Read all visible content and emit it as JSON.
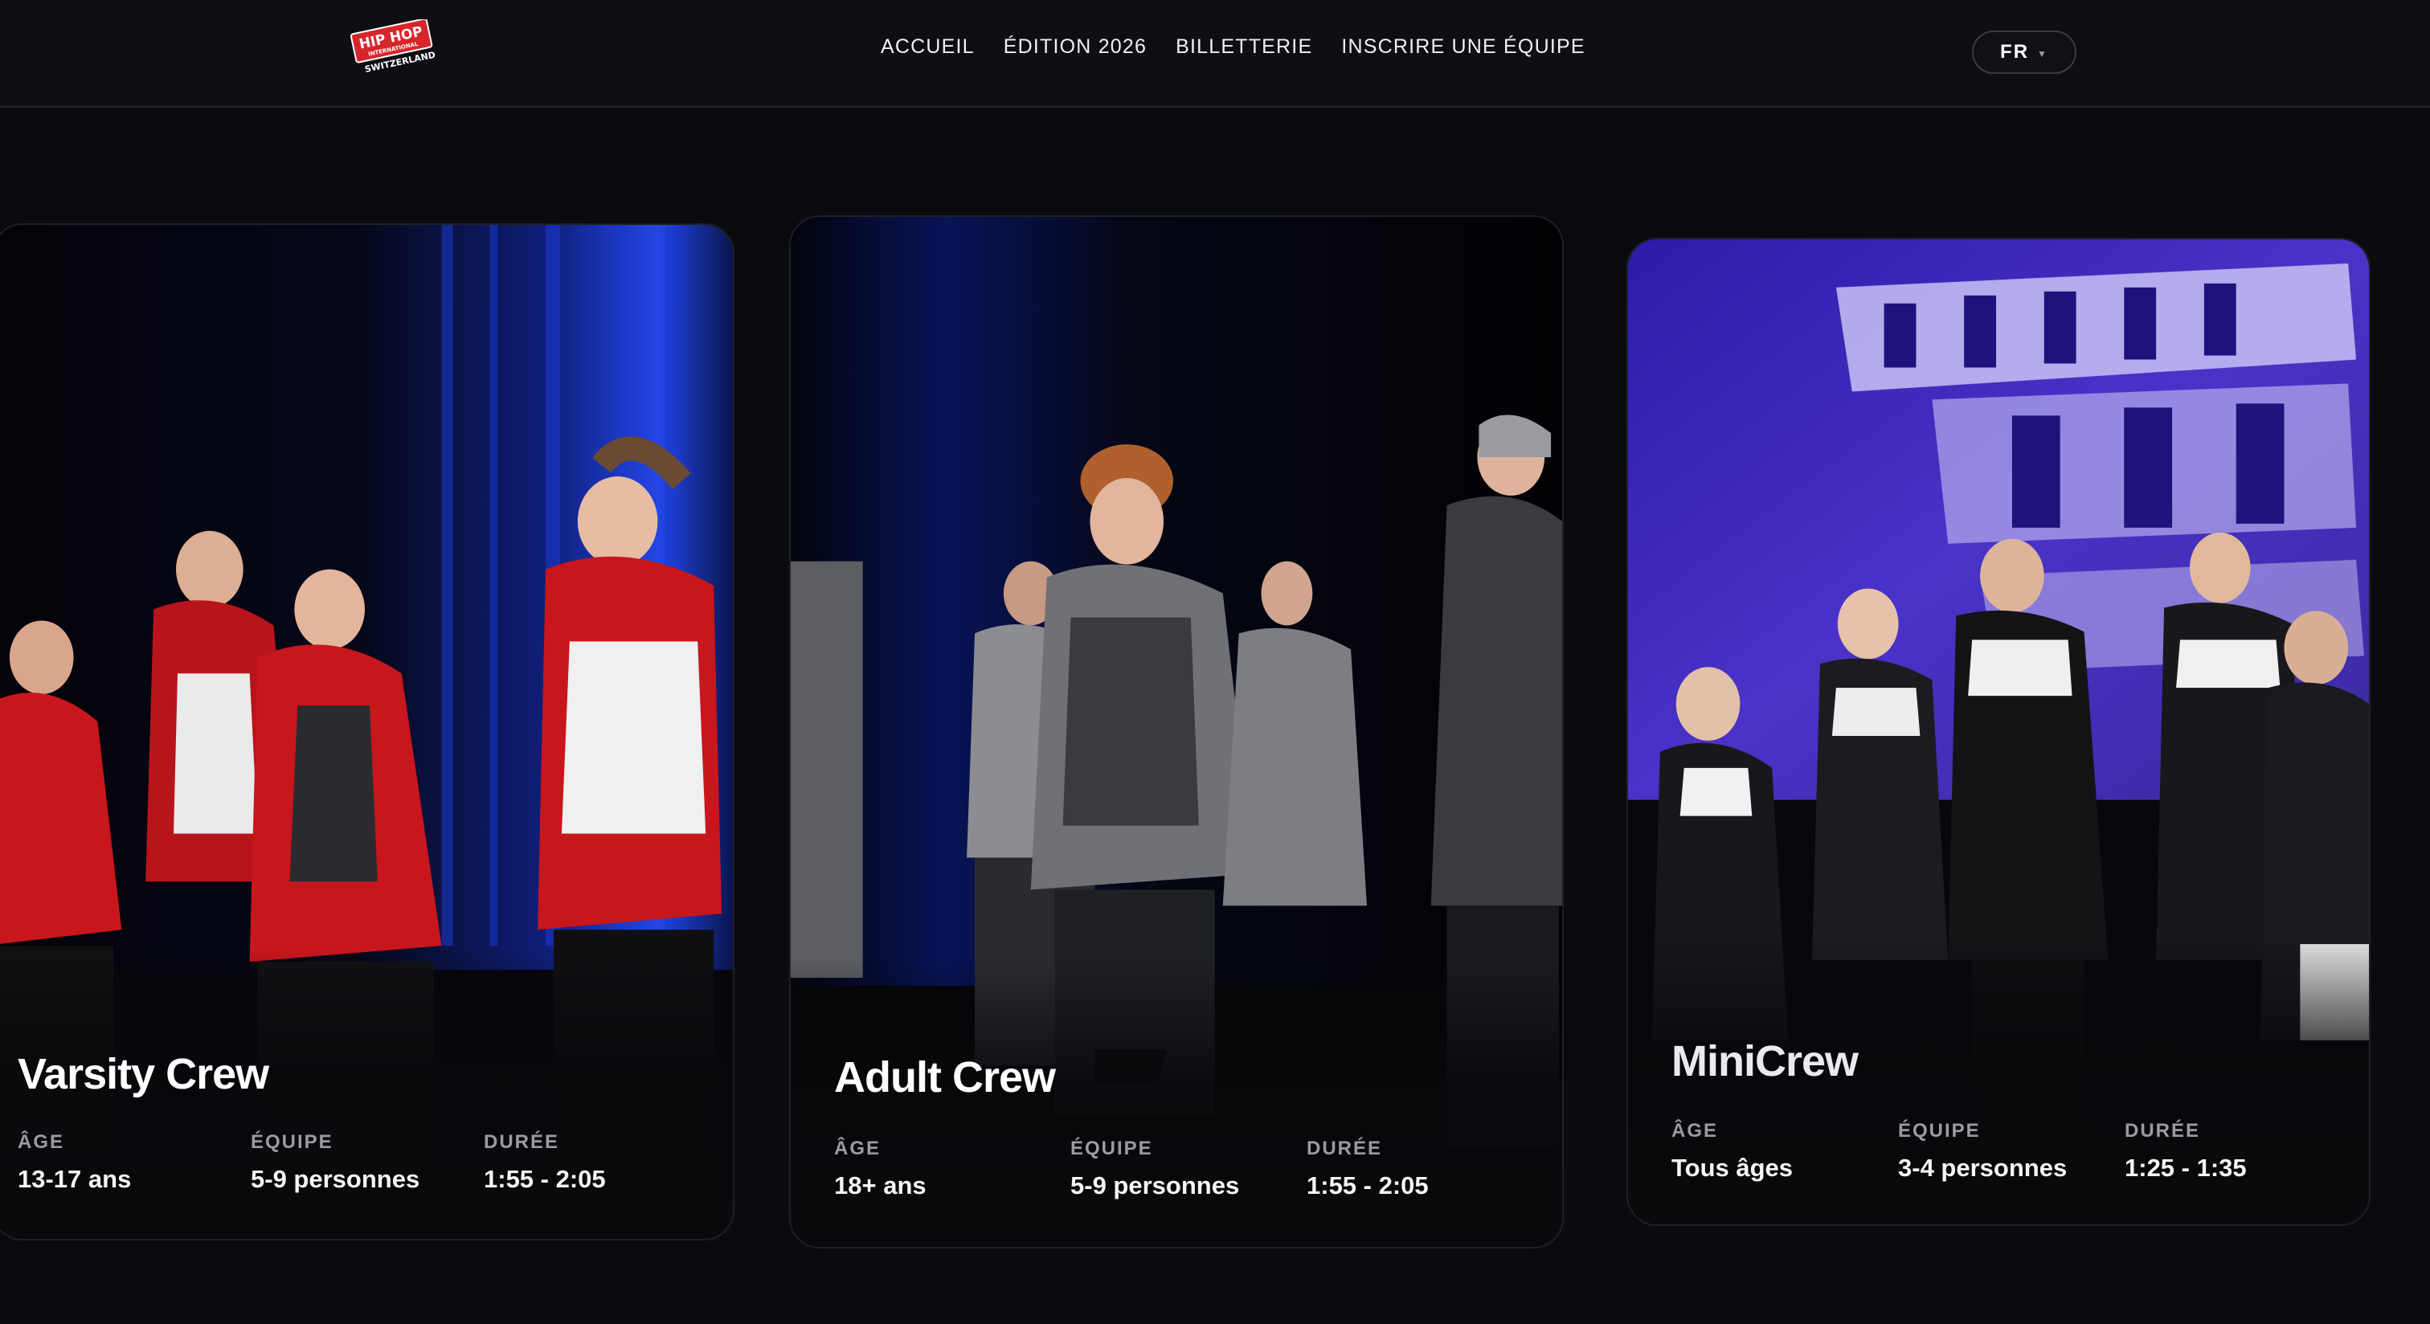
{
  "brand": {
    "logo_line1": "HIP HOP",
    "logo_line2": "INTERNATIONAL",
    "logo_line3": "SWITZERLAND"
  },
  "nav": {
    "items": [
      {
        "label": "ACCUEIL"
      },
      {
        "label": "ÉDITION 2026"
      },
      {
        "label": "BILLETTERIE"
      },
      {
        "label": "INSCRIRE UNE ÉQUIPE"
      }
    ]
  },
  "language": {
    "selected": "FR",
    "icon": "chevron-down-icon"
  },
  "categories": [
    {
      "title": "Varsity Crew",
      "stats": [
        {
          "label": "ÂGE",
          "value": "13-17 ans"
        },
        {
          "label": "ÉQUIPE",
          "value": "5-9 personnes"
        },
        {
          "label": "DURÉE",
          "value": "1:55 - 2:05"
        }
      ]
    },
    {
      "title": "Adult Crew",
      "stats": [
        {
          "label": "ÂGE",
          "value": "18+ ans"
        },
        {
          "label": "ÉQUIPE",
          "value": "5-9 personnes"
        },
        {
          "label": "DURÉE",
          "value": "1:55 - 2:05"
        }
      ]
    },
    {
      "title": "MiniCrew",
      "stats": [
        {
          "label": "ÂGE",
          "value": "Tous âges"
        },
        {
          "label": "ÉQUIPE",
          "value": "3-4 personnes"
        },
        {
          "label": "DURÉE",
          "value": "1:25 - 1:35"
        }
      ]
    }
  ],
  "colors": {
    "background": "#0b0b0f",
    "header": "#0e0f13",
    "brand_red": "#d7262b",
    "card_red": "#c8161d",
    "stage_blue": "#1d3fe0",
    "banner_purple": "#4a32c8"
  }
}
